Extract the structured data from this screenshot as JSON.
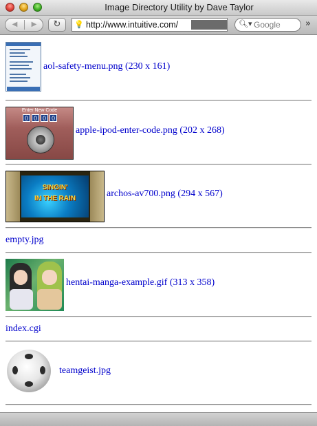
{
  "window": {
    "title": "Image Directory Utility by Dave Taylor"
  },
  "toolbar": {
    "back_icon": "back-arrow-icon",
    "forward_icon": "forward-arrow-icon",
    "reload_icon": "reload-icon",
    "url": "http://www.intuitive.com/",
    "search_placeholder": "Google",
    "overflow_icon": "chevron-double-right-icon"
  },
  "entries": [
    {
      "label": "aol-safety-menu.png (230 x 161)"
    },
    {
      "label": "apple-ipod-enter-code.png (202 x 268)",
      "thumb_header": "Enter New Code",
      "code_digits": [
        "0",
        "0",
        "0",
        "0"
      ]
    },
    {
      "label": "archos-av700.png (294 x 567)",
      "screen_line1": "SINGIN'",
      "screen_line2": "IN THE RAIN"
    },
    {
      "label": "empty.jpg"
    },
    {
      "label": "hentai-manga-example.gif (313 x 358)"
    },
    {
      "label": "index.cgi"
    },
    {
      "label": "teamgeist.jpg"
    }
  ]
}
